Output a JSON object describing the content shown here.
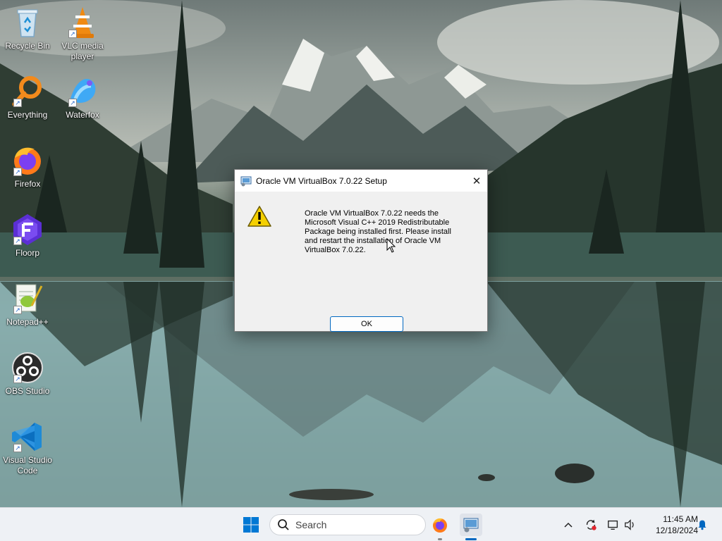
{
  "desktop": {
    "icons": [
      {
        "label": "Recycle Bin",
        "icon": "recycle-bin-icon"
      },
      {
        "label": "VLC media player",
        "icon": "vlc-icon"
      },
      {
        "label": "Everything",
        "icon": "everything-search-icon"
      },
      {
        "label": "Waterfox",
        "icon": "waterfox-icon"
      },
      {
        "label": "Firefox",
        "icon": "firefox-icon"
      },
      {
        "label": "Floorp",
        "icon": "floorp-icon"
      },
      {
        "label": "Notepad++",
        "icon": "notepadpp-icon"
      },
      {
        "label": "OBS Studio",
        "icon": "obs-icon"
      },
      {
        "label": "Visual Studio Code",
        "icon": "vscode-icon"
      }
    ]
  },
  "dialog": {
    "title": "Oracle VM VirtualBox 7.0.22 Setup",
    "close_glyph": "✕",
    "message": "Oracle VM VirtualBox 7.0.22 needs the\nMicrosoft Visual C++ 2019 Redistributable\nPackage being installed first. Please install\nand restart the installation of Oracle VM\nVirtualBox 7.0.22.",
    "ok_label": "OK",
    "icon": "warning-icon"
  },
  "taskbar": {
    "search_placeholder": "Search",
    "pinned": [
      "start-button",
      "search",
      "firefox",
      "virtualbox-setup"
    ],
    "clock": {
      "time": "11:45 AM",
      "date": "12/18/2024"
    },
    "accent": "#0067c0"
  }
}
